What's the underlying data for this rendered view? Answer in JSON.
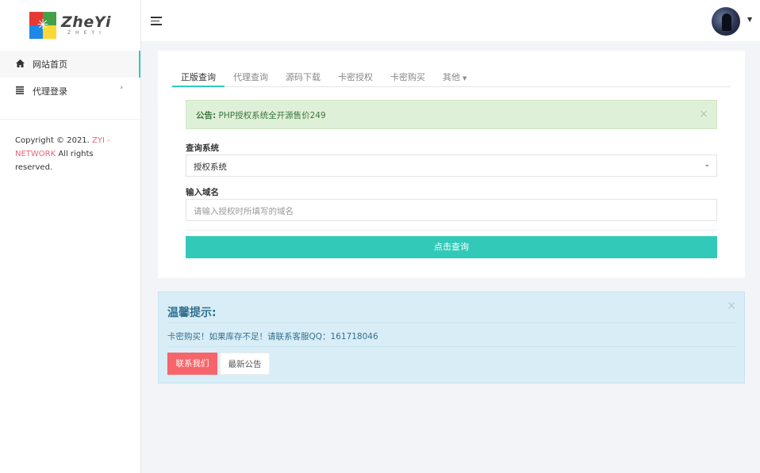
{
  "logo": {
    "name": "ZheYi",
    "tagline": "ZHEYI"
  },
  "sidebar": {
    "items": [
      {
        "label": "网站首页",
        "icon": "home-icon"
      },
      {
        "label": "代理登录",
        "icon": "list-icon"
      }
    ],
    "copyright": {
      "prefix": "Copyright © 2021. ",
      "brand": "ZYI - NETWORK",
      "suffix": " All rights reserved."
    }
  },
  "tabs": [
    {
      "label": "正版查询"
    },
    {
      "label": "代理查询"
    },
    {
      "label": "源码下载"
    },
    {
      "label": "卡密授权"
    },
    {
      "label": "卡密购买"
    },
    {
      "label": "其他"
    }
  ],
  "notice": {
    "title": "公告:",
    "text": " PHP授权系统全开源售价249",
    "close": "×"
  },
  "form": {
    "system_label": "查询系统",
    "system_value": "授权系统",
    "domain_label": "输入域名",
    "domain_placeholder": "请输入授权时所填写的域名",
    "submit_label": "点击查询"
  },
  "tips": {
    "title": "温馨提示:",
    "message": "卡密购买！如果库存不足！请联系客服QQ：161718046",
    "contact_label": "联系我们",
    "news_label": "最新公告",
    "close": "×"
  },
  "colors": {
    "accent": "#33c9b8",
    "danger": "#f5656a",
    "brand_pink": "#e8647f"
  }
}
